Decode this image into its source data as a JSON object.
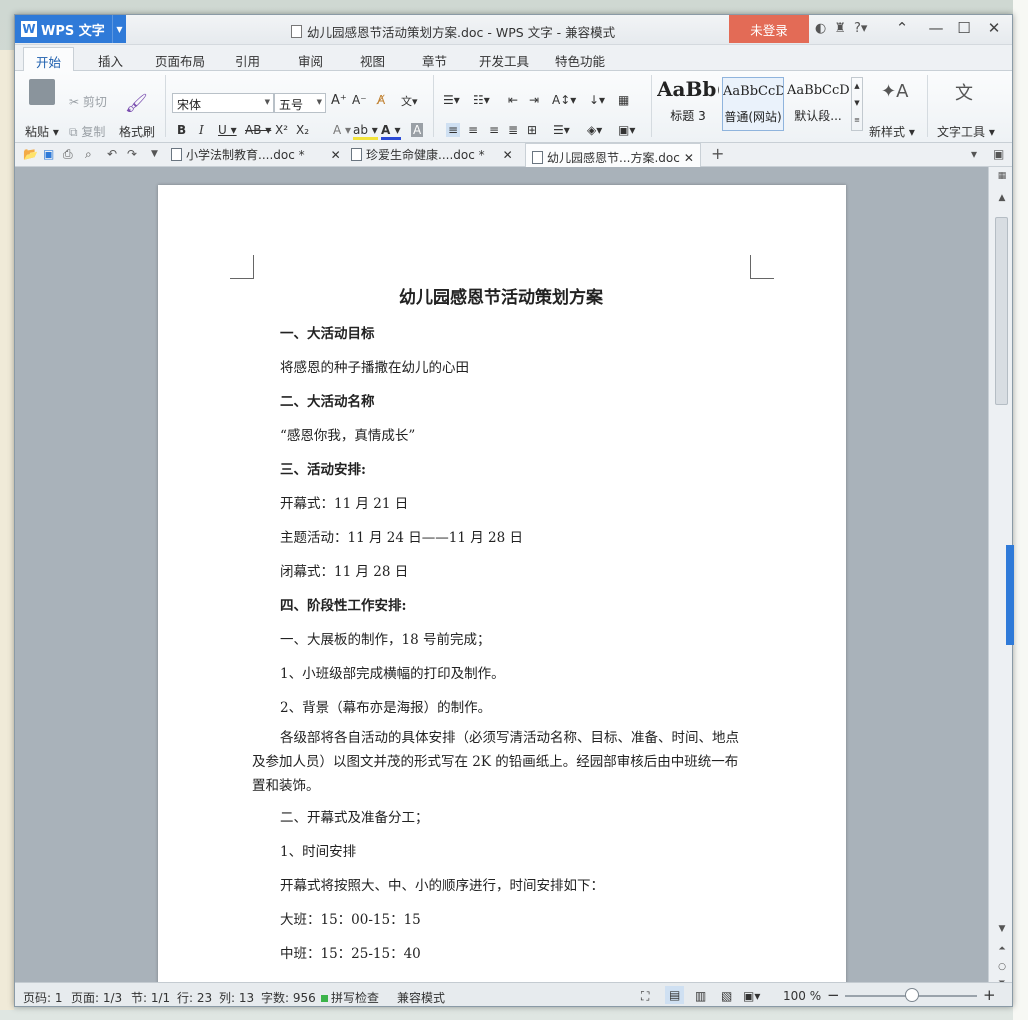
{
  "app": {
    "name": "WPS 文字",
    "logo_letter": "W"
  },
  "window": {
    "title": "幼儿园感恩节活动策划方案.doc - WPS 文字 - 兼容模式",
    "login_label": "未登录"
  },
  "ribbon_tabs": [
    "开始",
    "插入",
    "页面布局",
    "引用",
    "审阅",
    "视图",
    "章节",
    "开发工具",
    "特色功能"
  ],
  "ribbon": {
    "paste": "粘贴",
    "cut": "剪切",
    "copy": "复制",
    "format_painter": "格式刷",
    "font_name": "宋体",
    "font_size": "五号",
    "styles": [
      {
        "preview": "AaBb(",
        "label": "标题 3"
      },
      {
        "preview": "AaBbCcD",
        "label": "普通(网站)"
      },
      {
        "preview": "AaBbCcD",
        "label": "默认段..."
      }
    ],
    "new_style": "新样式",
    "text_tools": "文字工具"
  },
  "doc_tabs": [
    {
      "label": "小学法制教育....doc *",
      "active": false
    },
    {
      "label": "珍爱生命健康....doc *",
      "active": false
    },
    {
      "label": "幼儿园感恩节...方案.doc",
      "active": true
    }
  ],
  "document": {
    "title": "幼儿园感恩节活动策划方案",
    "lines": [
      {
        "text": "一、大活动目标",
        "bold": true
      },
      {
        "text": "将感恩的种子播撒在幼儿的心田",
        "bold": false
      },
      {
        "text": "二、大活动名称",
        "bold": true
      },
      {
        "text": "“感恩你我，真情成长”",
        "bold": false
      },
      {
        "text": "三、活动安排:",
        "bold": true
      },
      {
        "text": "开幕式：11 月 21 日",
        "bold": false
      },
      {
        "text": "主题活动：11 月 24 日——11 月 28 日",
        "bold": false
      },
      {
        "text": "闭幕式：11 月 28 日",
        "bold": false
      },
      {
        "text": "四、阶段性工作安排:",
        "bold": true
      },
      {
        "text": "一、大展板的制作，18 号前完成；",
        "bold": false
      },
      {
        "text": "1、小班级部完成横幅的打印及制作。",
        "bold": false
      },
      {
        "text": "2、背景（幕布亦是海报）的制作。",
        "bold": false
      }
    ],
    "paragraph": "各级部将各自活动的具体安排（必须写清活动名称、目标、准备、时间、地点及参加人员）以图文并茂的形式写在 2K 的铅画纸上。经园部审核后由中班统一布置和装饰。",
    "lines2": [
      {
        "text": "二、开幕式及准备分工；",
        "bold": false
      },
      {
        "text": "1、时间安排",
        "bold": false
      },
      {
        "text": "开幕式将按照大、中、小的顺序进行，时间安排如下：",
        "bold": false
      },
      {
        "text": "大班：15：00-15：15",
        "bold": false
      },
      {
        "text": "中班：15：25-15：40",
        "bold": false
      }
    ]
  },
  "status": {
    "page_code": "页码: 1",
    "pages": "页面: 1/3",
    "section": "节: 1/1",
    "row": "行: 23",
    "col": "列: 13",
    "word_count": "字数: 956",
    "spell_check": "拼写检查",
    "compat_mode": "兼容模式",
    "zoom": "100 %"
  },
  "colors": {
    "brand": "#2f7ad8",
    "login": "#e36b56"
  }
}
